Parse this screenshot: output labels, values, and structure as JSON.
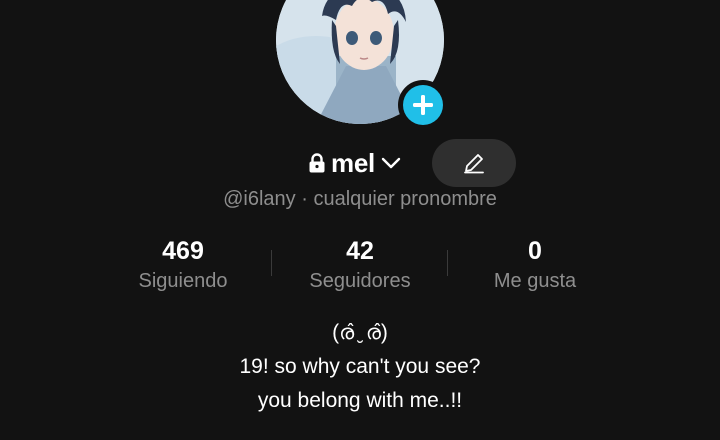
{
  "profile": {
    "display_name": "mel",
    "handle_line": "@i6lany · cualquier pronombre",
    "avatar_icon": "anime-avatar",
    "accent_color": "#20bfe8"
  },
  "stats": [
    {
      "value": "469",
      "label": "Siguiendo"
    },
    {
      "value": "42",
      "label": "Seguidores"
    },
    {
      "value": "0",
      "label": "Me gusta"
    }
  ],
  "bio": {
    "line1": "(ര̂ ̮ ര̂)",
    "line2": "19! so why can't you see?",
    "line3": "you belong with me..!!"
  },
  "icons": {
    "lock": "lock-icon",
    "chevron": "chevron-down-icon",
    "edit": "pencil-icon",
    "add": "plus-icon"
  }
}
